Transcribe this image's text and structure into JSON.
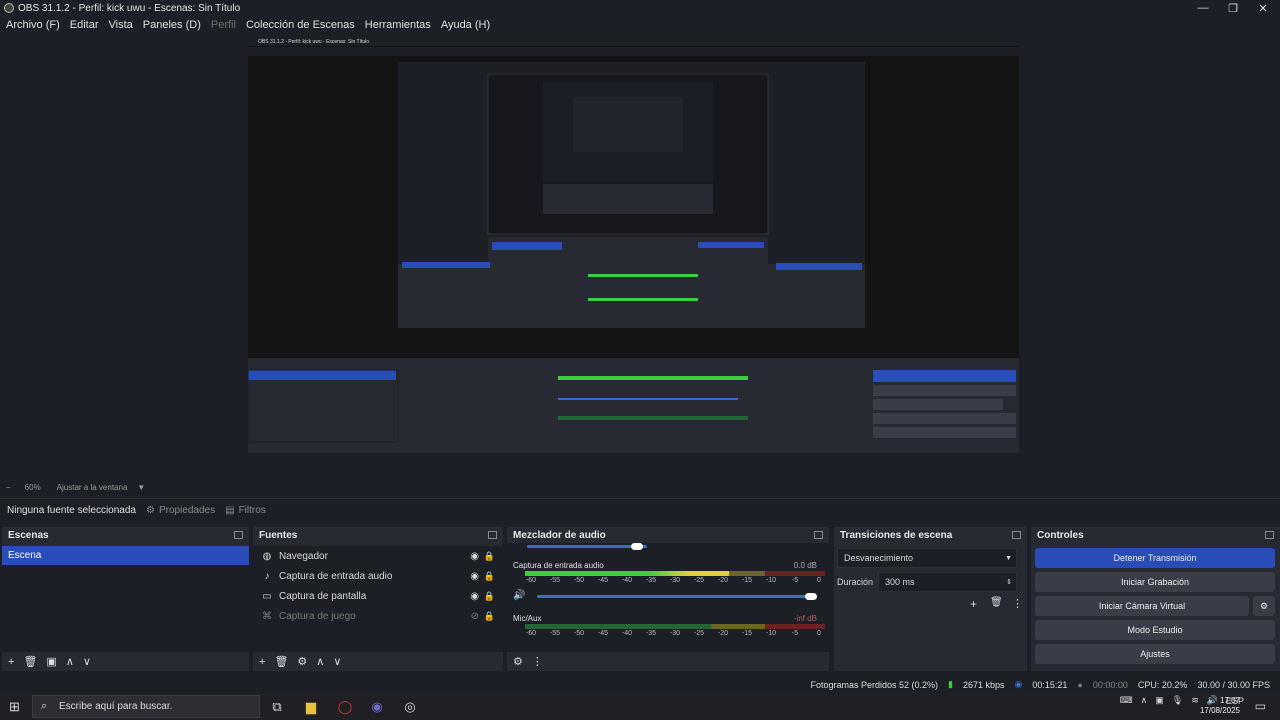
{
  "window": {
    "title": "OBS 31.1.2 - Perfil: kick uwu - Escenas: Sin Título"
  },
  "menu": [
    {
      "label": "Archivo (F)",
      "enabled": true
    },
    {
      "label": "Editar",
      "enabled": true
    },
    {
      "label": "Vista",
      "enabled": true
    },
    {
      "label": "Paneles (D)",
      "enabled": true
    },
    {
      "label": "Perfil",
      "enabled": false
    },
    {
      "label": "Colección de Escenas",
      "enabled": true
    },
    {
      "label": "Herramientas",
      "enabled": true
    },
    {
      "label": "Ayuda (H)",
      "enabled": true
    }
  ],
  "zoom": {
    "minus": "−",
    "value": "60%",
    "fit_label": "Ajustar a la ventana"
  },
  "properties_bar": {
    "no_source": "Ninguna fuente seleccionada",
    "properties": "Propiedades",
    "filters": "Filtros"
  },
  "scenes": {
    "title": "Escenas",
    "items": [
      "Escena"
    ]
  },
  "sources": {
    "title": "Fuentes",
    "items": [
      {
        "label": "Navegador",
        "icon": "globe-icon"
      },
      {
        "label": "Captura de entrada audio",
        "icon": "mic-icon"
      },
      {
        "label": "Captura de pantalla",
        "icon": "monitor-icon"
      },
      {
        "label": "Captura de juego",
        "icon": "gamepad-icon",
        "hidden": true
      }
    ]
  },
  "mixer": {
    "title": "Mezclador de audio",
    "channels": [
      {
        "name": "Captura de entrada audio",
        "db": "0.0 dB",
        "level": 0.68
      },
      {
        "name": "Mic/Aux",
        "db": "-inf dB",
        "level": 0.0
      }
    ],
    "ticks": [
      "-60",
      "-55",
      "-50",
      "-45",
      "-40",
      "-35",
      "-30",
      "-25",
      "-20",
      "-15",
      "-10",
      "-5",
      "0"
    ]
  },
  "transitions": {
    "title": "Transiciones de escena",
    "type": "Desvanecimiento",
    "duration_label": "Duración",
    "duration_value": "300 ms"
  },
  "controls": {
    "title": "Controles",
    "stop_stream": "Detener Transmisión",
    "start_recording": "Iniciar Grabación",
    "virtual_cam": "Iniciar Cámara Virtual",
    "studio_mode": "Modo Estudio",
    "settings": "Ajustes"
  },
  "status": {
    "dropped": "Fotogramas Perdidos 52 (0.2%)",
    "bitrate": "2671 kbps",
    "stream_time": "00:15:21",
    "rec_time": "00:00:00",
    "cpu": "CPU: 20.2%",
    "fps": "30.00 / 30.00 FPS"
  },
  "taskbar": {
    "search_placeholder": "Escribe aquí para buscar.",
    "lang": "ESP",
    "time": "17:07",
    "date": "17/08/2025"
  },
  "nested": {
    "title": "OBS 31.1.2 - Perfil: kick uwu - Escenas: Sin Título"
  }
}
